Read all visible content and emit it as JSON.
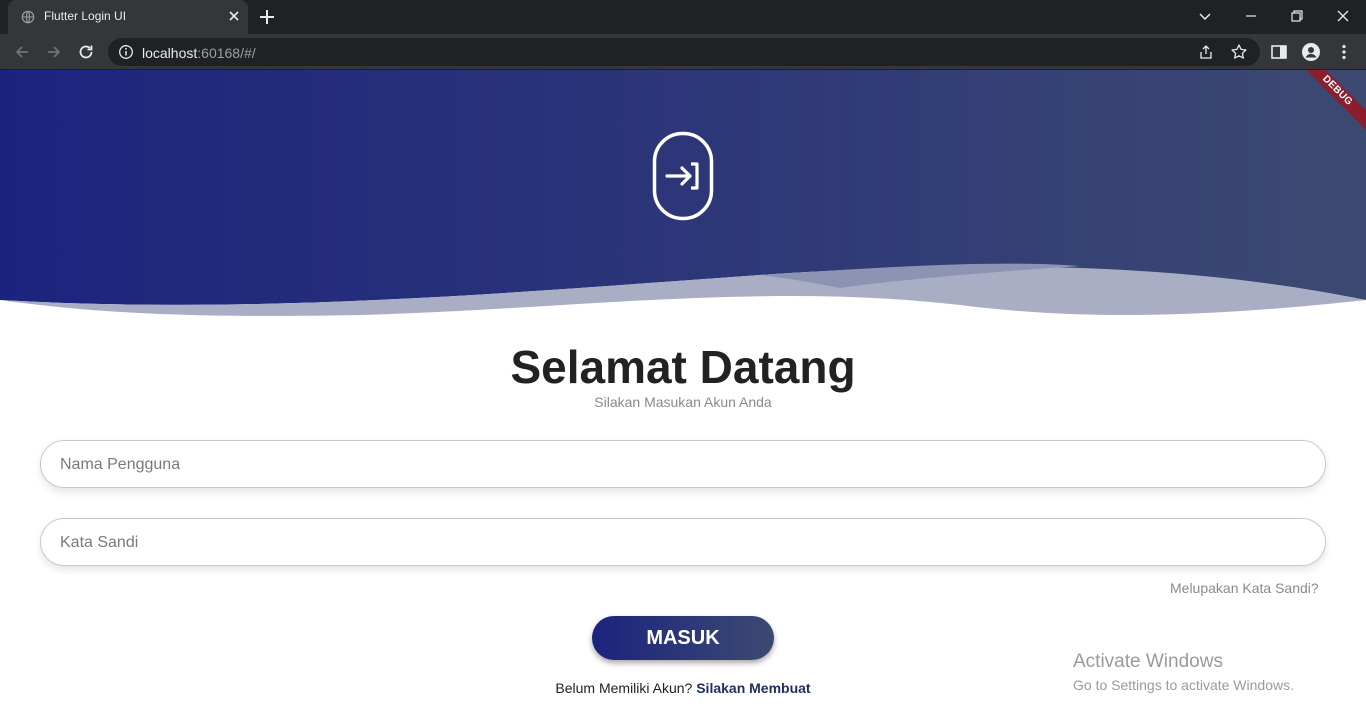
{
  "browser": {
    "tab_title": "Flutter Login UI",
    "url_host": "localhost",
    "url_rest": ":60168/#/"
  },
  "app": {
    "debug_banner": "DEBUG",
    "welcome_title": "Selamat Datang",
    "subtitle": "Silakan Masukan Akun Anda",
    "username_placeholder": "Nama Pengguna",
    "password_placeholder": "Kata Sandi",
    "forgot_password": "Melupakan Kata Sandi?",
    "login_button": "MASUK",
    "register_prompt": "Belum Memiliki Akun?",
    "register_link": "Silakan Membuat",
    "colors": {
      "header_gradient_start": "#1c237e",
      "header_gradient_end": "#3c4a72",
      "wave": "#a9aec5",
      "link": "#1f2e5e"
    }
  },
  "os_overlay": {
    "title": "Activate Windows",
    "subtitle": "Go to Settings to activate Windows."
  },
  "icons": {
    "tab": "globe-icon",
    "login": "login-arrow-icon"
  }
}
